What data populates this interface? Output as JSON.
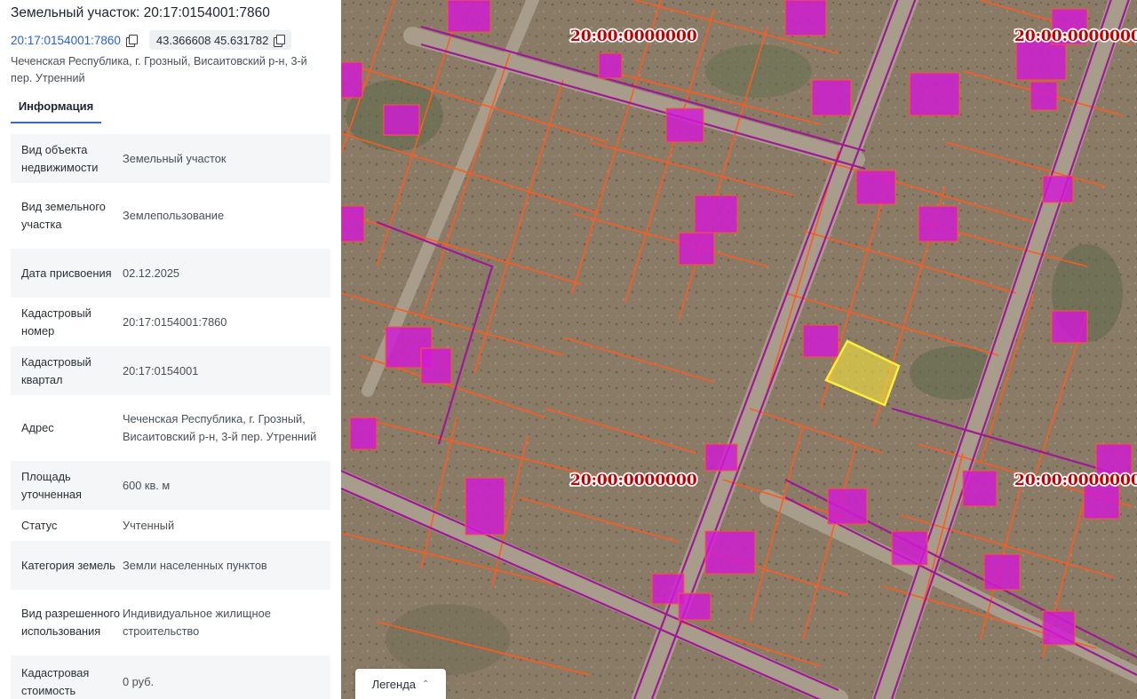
{
  "object": {
    "title": "Земельный участок: 20:17:0154001:7860",
    "cadastral_link": "20:17:0154001:7860",
    "coordinates": "43.366608 45.631782",
    "address": "Чеченская Республика, г. Грозный, Висаитовский р-н, 3-й пер. Утренний"
  },
  "icons": {
    "copy_cadastral": "copy-icon",
    "copy_coordinates": "copy-icon",
    "legend_toggle": "chevron-up-icon"
  },
  "tabs": [
    {
      "label": "Информация",
      "active": true
    }
  ],
  "info_rows": [
    {
      "label": "Вид объекта недвижимости",
      "value": "Земельный участок"
    },
    {
      "label": "Вид земельного участка",
      "value": "Землепользование"
    },
    {
      "label": "Дата присвоения",
      "value": "02.12.2025"
    },
    {
      "label": "Кадастровый номер",
      "value": "20:17:0154001:7860"
    },
    {
      "label": "Кадастровый квартал",
      "value": "20:17:0154001"
    },
    {
      "label": "Адрес",
      "value": "Чеченская Республика, г. Грозный, Висаитовский р-н, 3-й пер. Утренний"
    },
    {
      "label": "Площадь уточненная",
      "value": "600 кв. м"
    },
    {
      "label": "Статус",
      "value": "Учтенный"
    },
    {
      "label": "Категория земель",
      "value": "Земли населенных пунктов"
    },
    {
      "label": "Вид разрешенного использования",
      "value": "Индивидуальное жилищное строительство"
    },
    {
      "label": "Кадастровая стоимость",
      "value": "0 руб."
    }
  ],
  "map": {
    "quarter_labels": [
      "20:00:0000000",
      "20:00:0000000",
      "20:00:0000000",
      "20:00:0000000"
    ],
    "legend_label": "Легенда",
    "colors": {
      "satellite_ground": "#8a7b67",
      "road": "#a79c8a",
      "parcel_outline": "#ff5a1f",
      "quarter_boundary": "#a0179a",
      "building_fill": "#d21ad6",
      "selected_parcel": "#ffef3a",
      "quarter_label": "#c00000"
    }
  }
}
